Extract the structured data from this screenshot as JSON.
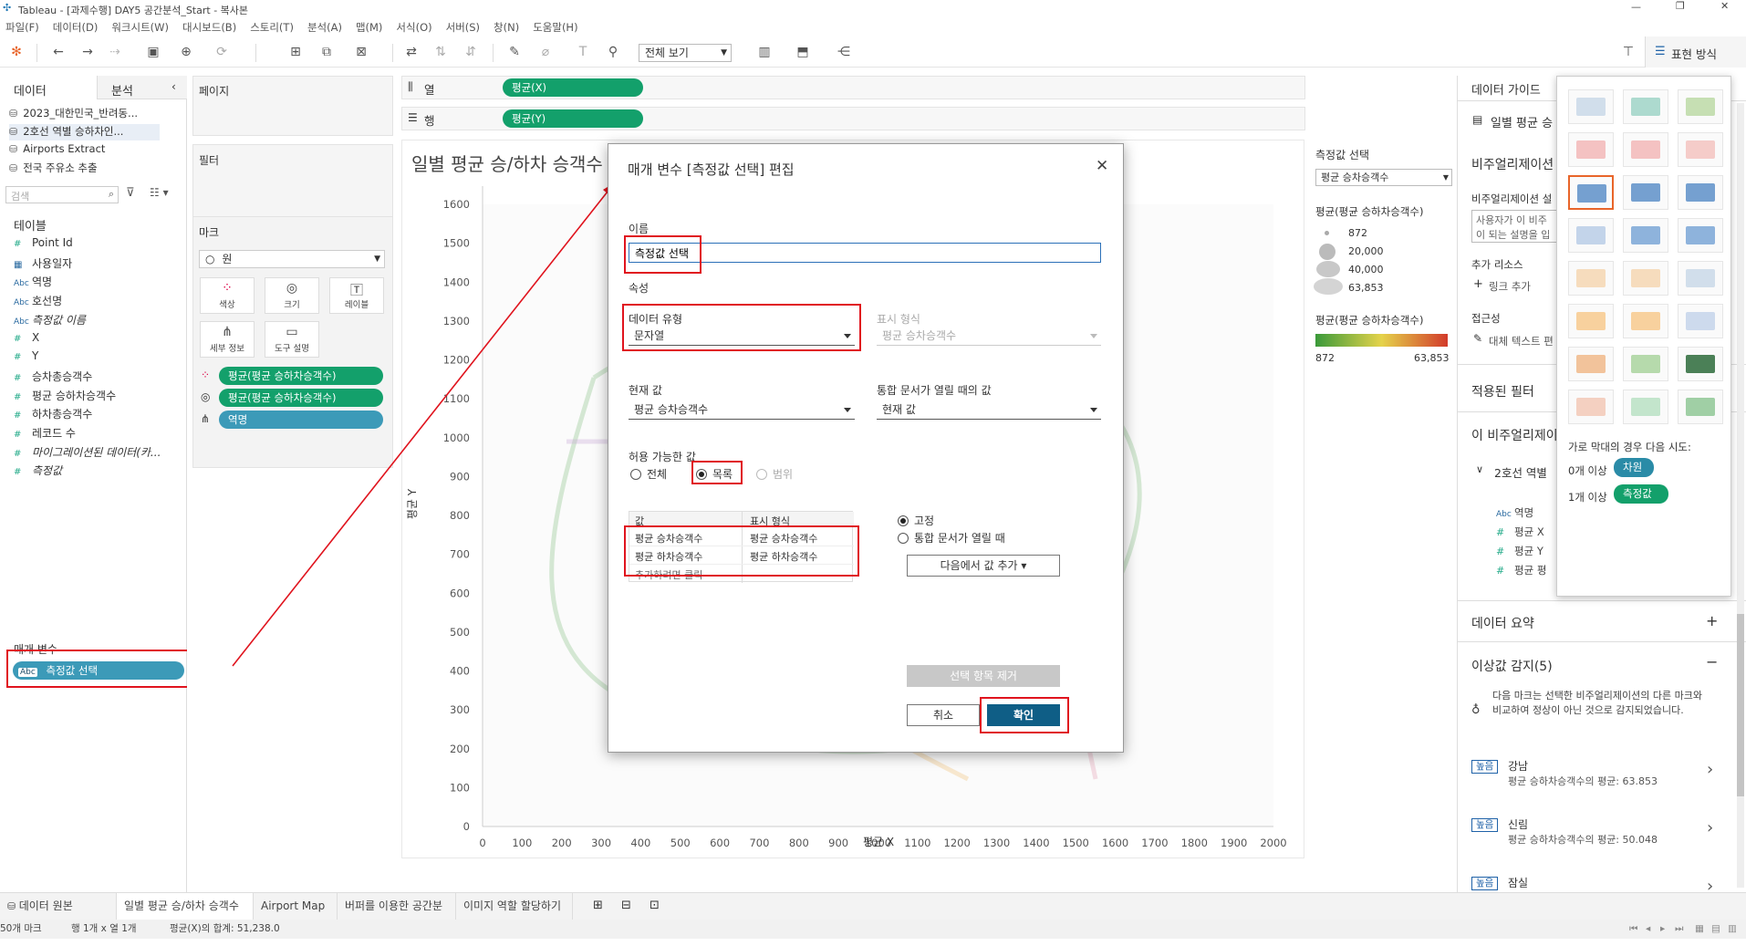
{
  "window": {
    "title": "Tableau - [과제수행] DAY5 공간분석_Start - 복사본"
  },
  "menu": [
    "파일(F)",
    "데이터(D)",
    "워크시트(W)",
    "대시보드(B)",
    "스토리(T)",
    "분석(A)",
    "맵(M)",
    "서식(O)",
    "서버(S)",
    "창(N)",
    "도움말(H)"
  ],
  "toolbar": {
    "view_select": "전체 보기",
    "show_me": "표현 방식"
  },
  "left": {
    "tab_data": "데이터",
    "tab_analysis": "분석",
    "sources": [
      "2023_대한민국_반려동...",
      "2호선 역별 승하차인...",
      "Airports Extract",
      "전국 주유소 추출"
    ],
    "search_placeholder": "검색",
    "tables_label": "테이블",
    "fields": [
      {
        "type": "#",
        "name": "Point Id"
      },
      {
        "type": "date",
        "name": "사용일자"
      },
      {
        "type": "Abc",
        "name": "역명"
      },
      {
        "type": "Abc",
        "name": "호선명"
      },
      {
        "type": "Abc",
        "name": "측정값 이름"
      },
      {
        "type": "#",
        "name": "X"
      },
      {
        "type": "#",
        "name": "Y"
      },
      {
        "type": "#",
        "name": "승차총승객수"
      },
      {
        "type": "#",
        "name": "평균 승하차승객수"
      },
      {
        "type": "#",
        "name": "하차총승객수"
      },
      {
        "type": "#",
        "name": "레코드 수"
      },
      {
        "type": "#",
        "name": "마이그레이션된 데이터(카..."
      },
      {
        "type": "#",
        "name": "측정값"
      }
    ],
    "params_label": "매개 변수",
    "param_pill": "측정값 선택"
  },
  "shelves": {
    "pages": "페이지",
    "filters": "필터",
    "marks": "마크",
    "mark_type": "원",
    "mark_buttons": [
      "색상",
      "크기",
      "레이블",
      "세부 정보",
      "도구 설명"
    ],
    "mark_pills": [
      "평균(평균 승하차승객수)",
      "평균(평균 승하차승객수)",
      "역명"
    ],
    "columns_label": "열",
    "rows_label": "행",
    "columns_pill": "평균(X)",
    "rows_pill": "평균(Y)"
  },
  "chart": {
    "title": "일별 평균 승/하차 승객수",
    "ylabel": "평균 Y",
    "xlabel": "평균 X",
    "yticks": [
      "1600",
      "1500",
      "1400",
      "1300",
      "1200",
      "1100",
      "1000",
      "900",
      "800",
      "700",
      "600",
      "500",
      "400",
      "300",
      "200",
      "100",
      "0"
    ],
    "xticks": [
      "0",
      "100",
      "200",
      "300",
      "400",
      "500",
      "600",
      "700",
      "800",
      "900",
      "1000",
      "1100",
      "1200",
      "1300",
      "1400",
      "1500",
      "1600",
      "1700",
      "1800",
      "1900",
      "2000"
    ]
  },
  "chart_data": {
    "type": "scatter",
    "title": "일별 평균 승/하차 승객수",
    "xlabel": "평균 X",
    "ylabel": "평균 Y",
    "xlim": [
      0,
      2000
    ],
    "ylim": [
      0,
      1600
    ],
    "x_ticks": [
      0,
      100,
      200,
      300,
      400,
      500,
      600,
      700,
      800,
      900,
      1000,
      1100,
      1200,
      1300,
      1400,
      1500,
      1600,
      1700,
      1800,
      1900,
      2000
    ],
    "y_ticks": [
      0,
      100,
      200,
      300,
      400,
      500,
      600,
      700,
      800,
      900,
      1000,
      1100,
      1200,
      1300,
      1400,
      1500,
      1600
    ]
  },
  "legend": {
    "param_title": "측정값 선택",
    "param_value": "평균 승차승객수",
    "size_title": "평균(평균 승하차승객수)",
    "size_values": [
      "872",
      "20,000",
      "40,000",
      "63,853"
    ],
    "color_title": "평균(평균 승하차승객수)",
    "color_min": "872",
    "color_max": "63,853"
  },
  "dialog": {
    "title": "매개 변수 [측정값 선택] 편집",
    "name_label": "이름",
    "name_value": "측정값 선택",
    "props_label": "속성",
    "data_type_label": "데이터 유형",
    "data_type_value": "문자열",
    "format_label": "표시 형식",
    "format_value": "평균 승차승객수",
    "current_label": "현재 값",
    "current_value": "평균 승차승객수",
    "workbook_open_label": "통합 문서가 열릴 때의 값",
    "workbook_open_value": "현재 값",
    "allowed_label": "허용 가능한 값",
    "allowed_options": [
      "전체",
      "목록",
      "범위"
    ],
    "list_header_value": "값",
    "list_header_display": "표시 형식",
    "list_rows": [
      {
        "value": "평균 승차승객수",
        "display": "평균 승차승객수"
      },
      {
        "value": "평균 하차승객수",
        "display": "평균 하차승객수"
      }
    ],
    "list_add_hint": "추가하려면 클릭",
    "fixed_label": "고정",
    "on_open_label": "통합 문서가 열릴 때",
    "add_from_label": "다음에서 값 추가 ▾",
    "remove_label": "선택 항목 제거",
    "cancel_label": "취소",
    "ok_label": "확인"
  },
  "right": {
    "guide_title": "데이터 가이드",
    "sheet_item": "일별 평균 승",
    "viz_header": "비주얼리제이션",
    "viz_desc_label": "비주얼리제이션 설",
    "viz_desc_placeholder": "사용자가 이 비주\n이 되는 설명을 입",
    "extra_resources": "추가 리소스",
    "add_link": "링크 추가",
    "accessibility": "접근성",
    "alt_text": "대체 텍스트 편",
    "applied_filters": "적용된 필터",
    "this_viz": "이 비주얼리제이",
    "tree_node": "2호선 역별",
    "tree_items": [
      "역명",
      "평균 X",
      "평균 Y",
      "평균 평"
    ],
    "data_summary": "데이터 요약",
    "outliers": "이상값 감지(5)",
    "outlier_desc": "다음 마크는 선택한 비주얼리제이션의 다른 마크와 비교하여 정상이 아닌 것으로 감지되었습니다.",
    "outlier_items": [
      {
        "badge": "높음",
        "name": "강남",
        "detail": "평균 승하차승객수의 평균: 63.853"
      },
      {
        "badge": "높음",
        "name": "신림",
        "detail": "평균 승하차승객수의 평균: 50.048"
      },
      {
        "badge": "높음",
        "name": "잠실",
        "detail": ""
      }
    ]
  },
  "showme": {
    "hint": "가로 막대의 경우 다음 시도:",
    "req1_prefix": "0개 이상",
    "req1_pill": "차원",
    "req2_prefix": "1개 이상",
    "req2_pill": "측정값"
  },
  "tabs": [
    "데이터 원본",
    "일별 평균 승/하차 승객수",
    "Airport Map",
    "버퍼를 이용한 공간분석",
    "이미지 역할 할당하기"
  ],
  "status": {
    "marks": "50개 마크",
    "rows_cols": "행 1개 x 열 1개",
    "sum": "평균(X)의 합계: 51,238.0"
  },
  "colors": {
    "green_pill": "#13a06b",
    "blue_pill": "#3c9ab8",
    "ok_button": "#0f5e86",
    "highlight": "#e0141e",
    "accent": "#e8652a"
  }
}
